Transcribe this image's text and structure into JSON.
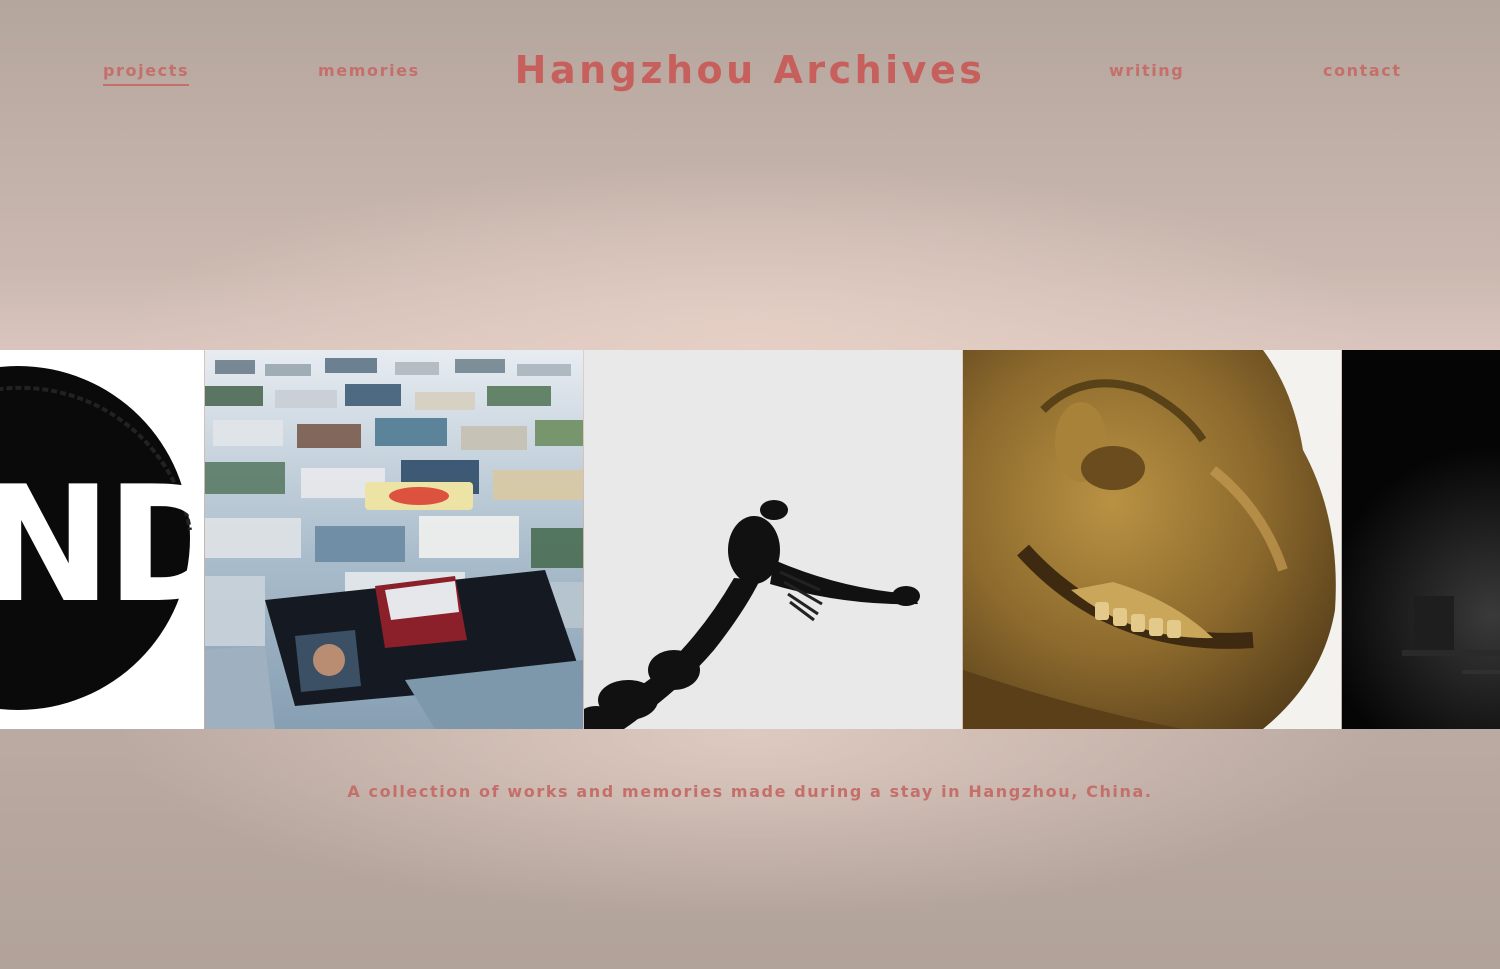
{
  "nav": {
    "left": [
      {
        "label": "projects",
        "active": true
      },
      {
        "label": "memories",
        "active": false
      }
    ],
    "right": [
      {
        "label": "writing",
        "active": false
      },
      {
        "label": "contact",
        "active": false
      }
    ]
  },
  "site_title": "Hangzhou Archives",
  "gallery": {
    "tiles": [
      {
        "name": "stamp-logo-artwork",
        "logo_text": "ND"
      },
      {
        "name": "scattered-photos-artwork",
        "logo_text": ""
      },
      {
        "name": "ink-creature-artwork",
        "logo_text": ""
      },
      {
        "name": "bronze-face-sculpture-artwork",
        "logo_text": ""
      },
      {
        "name": "dark-installation-artwork",
        "logo_text": ""
      }
    ]
  },
  "caption": "A collection of works and memories made during a stay in Hangzhou, China.",
  "colors": {
    "accent": "#c46f6a",
    "title": "#c7605c",
    "background": "#c8b6ad"
  }
}
